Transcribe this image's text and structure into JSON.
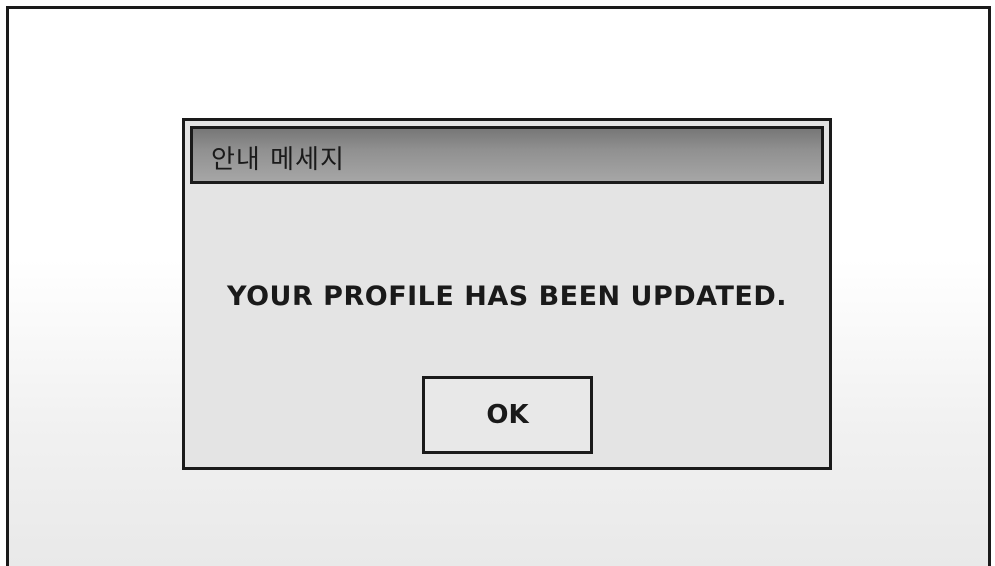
{
  "dialog": {
    "title": "안내 메세지",
    "message": "YOUR PROFILE HAS BEEN UPDATED.",
    "ok_label": "OK"
  }
}
